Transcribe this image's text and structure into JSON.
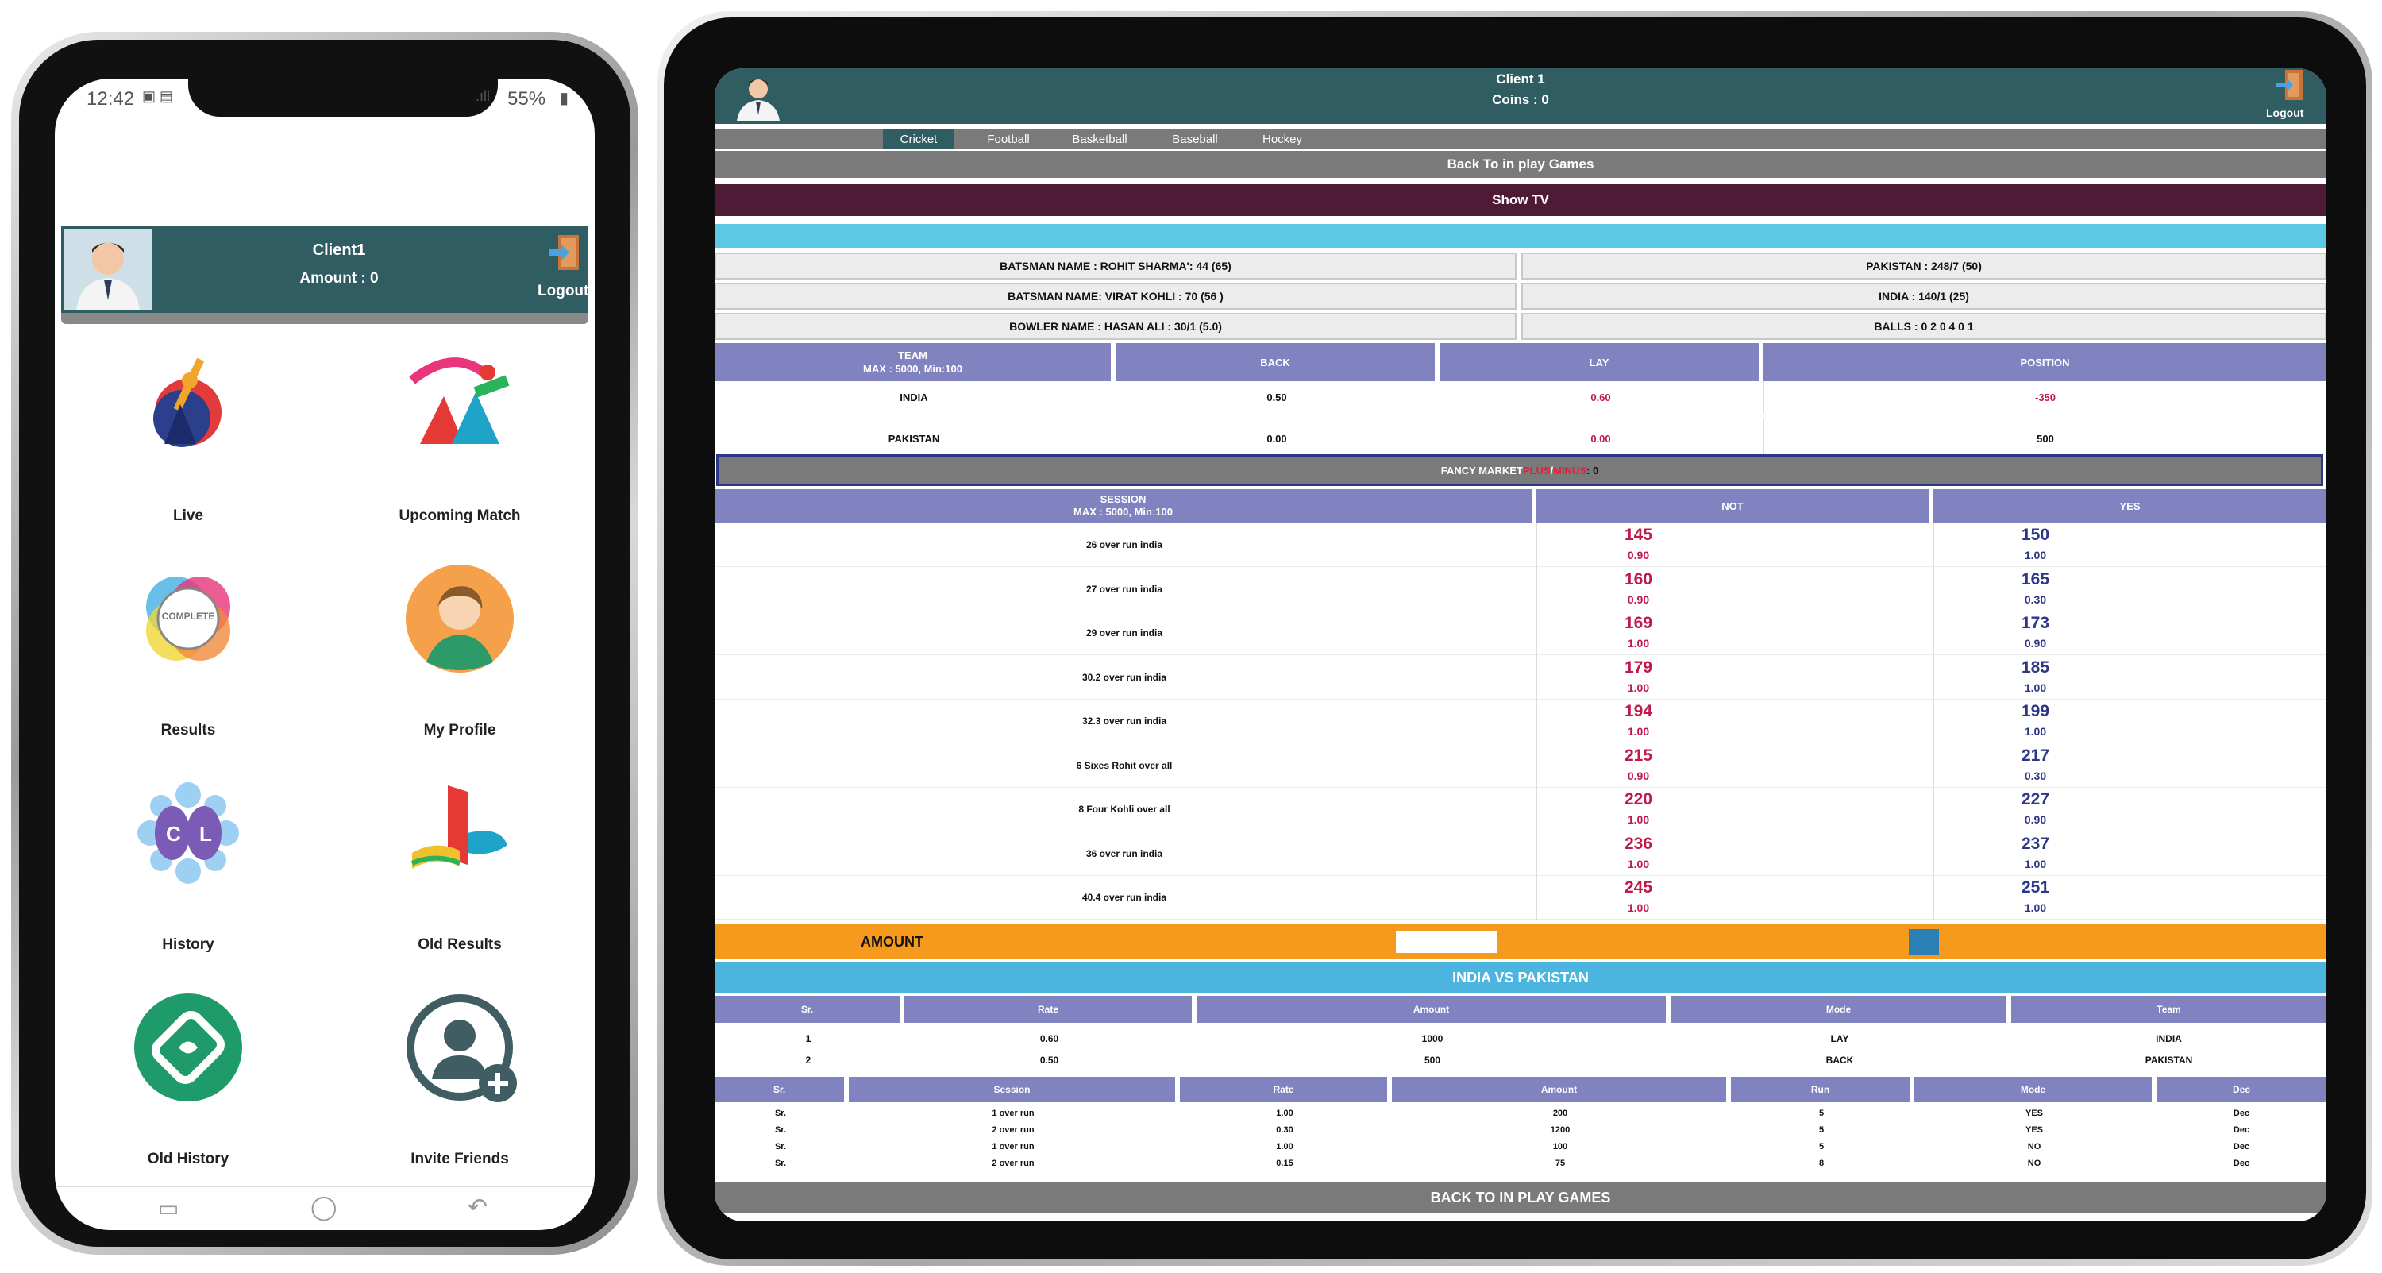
{
  "phone": {
    "status": {
      "time": "12:42",
      "battery": "55%"
    },
    "header": {
      "client": "Client1",
      "amount": "Amount : 0",
      "logout": "Logout"
    },
    "grid": [
      {
        "label": "Live",
        "icon": "cricket-batsman-icon"
      },
      {
        "label": "Upcoming Match",
        "icon": "upcoming-match-icon"
      },
      {
        "label": "Results",
        "icon": "results-complete-icon"
      },
      {
        "label": "My Profile",
        "icon": "profile-avatar-icon"
      },
      {
        "label": "History",
        "icon": "history-cl-icon"
      },
      {
        "label": "Old Results",
        "icon": "old-results-icon"
      },
      {
        "label": "Old History",
        "icon": "old-history-icon"
      },
      {
        "label": "Invite Friends",
        "icon": "invite-friends-icon"
      }
    ],
    "complete_badge": "COMPLETE"
  },
  "tablet": {
    "header": {
      "client": "Client 1",
      "coins": "Coins : 0",
      "logout": "Logout"
    },
    "tabs": [
      "Cricket",
      "Football",
      "Basketball",
      "Baseball",
      "Hockey"
    ],
    "back_top": "Back To in play Games",
    "show_tv": "Show TV",
    "score": {
      "left": [
        "BATSMAN NAME : ROHIT SHARMA': 44 (65)",
        "BATSMAN NAME: VIRAT KOHLI : 70 (56 )",
        "BOWLER NAME : HASAN ALI : 30/1 (5.0)"
      ],
      "right": [
        "PAKISTAN : 248/7 (50)",
        "INDIA : 140/1 (25)",
        "BALLS : 0 2 0 4 0 1"
      ]
    },
    "match_table": {
      "team_header": "TEAM",
      "team_limit": "MAX : 5000, Min:100",
      "back": "BACK",
      "lay": "LAY",
      "position": "POSITION",
      "rows": [
        {
          "team": "INDIA",
          "back": "0.50",
          "lay": "0.60",
          "position": "-350"
        },
        {
          "team": "PAKISTAN",
          "back": "0.00",
          "lay": "0.00",
          "position": "500"
        }
      ]
    },
    "fancy": {
      "label": "FANCY MARKET ",
      "plus": "PLUS",
      "slash": "/",
      "minus": "MINUS",
      "value": " : 0"
    },
    "session_table": {
      "session_header": "SESSION",
      "session_limit": "MAX : 5000, Min:100",
      "not": "NOT",
      "yes": "YES",
      "rows": [
        {
          "name": "26 over run india",
          "not": "145",
          "not_rate": "0.90",
          "yes": "150",
          "yes_rate": "1.00"
        },
        {
          "name": "27 over run india",
          "not": "160",
          "not_rate": "0.90",
          "yes": "165",
          "yes_rate": "0.30"
        },
        {
          "name": "29 over run india",
          "not": "169",
          "not_rate": "1.00",
          "yes": "173",
          "yes_rate": "0.90"
        },
        {
          "name": "30.2 over run india",
          "not": "179",
          "not_rate": "1.00",
          "yes": "185",
          "yes_rate": "1.00"
        },
        {
          "name": "32.3 over run india",
          "not": "194",
          "not_rate": "1.00",
          "yes": "199",
          "yes_rate": "1.00"
        },
        {
          "name": "6 Sixes Rohit  over all",
          "not": "215",
          "not_rate": "0.90",
          "yes": "217",
          "yes_rate": "0.30"
        },
        {
          "name": "8 Four Kohli over all",
          "not": "220",
          "not_rate": "1.00",
          "yes": "227",
          "yes_rate": "0.90"
        },
        {
          "name": "36 over run india",
          "not": "236",
          "not_rate": "1.00",
          "yes": "237",
          "yes_rate": "1.00"
        },
        {
          "name": "40.4 over run india",
          "not": "245",
          "not_rate": "1.00",
          "yes": "251",
          "yes_rate": "1.00"
        }
      ]
    },
    "amount_label": "AMOUNT",
    "amount_input": "",
    "vs_title": "INDIA VS PAKISTAN",
    "bets_table": {
      "headers": [
        "Sr.",
        "Rate",
        "Amount",
        "Mode",
        "Team"
      ],
      "rows": [
        [
          "1",
          "0.60",
          "1000",
          "LAY",
          "INDIA"
        ],
        [
          "2",
          "0.50",
          "500",
          "BACK",
          "PAKISTAN"
        ]
      ]
    },
    "session_bets": {
      "headers": [
        "Sr.",
        "Session",
        "Rate",
        "Amount",
        "Run",
        "Mode",
        "Dec"
      ],
      "rows": [
        [
          "Sr.",
          "1 over run",
          "1.00",
          "200",
          "5",
          "YES",
          "Dec"
        ],
        [
          "Sr.",
          "2 over run",
          "0.30",
          "1200",
          "5",
          "YES",
          "Dec"
        ],
        [
          "Sr.",
          "1 over run",
          "1.00",
          "100",
          "5",
          "NO",
          "Dec"
        ],
        [
          "Sr.",
          "2 over run",
          "0.15",
          "75",
          "8",
          "NO",
          "Dec"
        ]
      ]
    },
    "back_bottom": "BACK TO IN PLAY GAMES"
  },
  "colors": {
    "header": "#2f5d62",
    "tab_gray": "#7a7a7a",
    "tv": "#4e1a36",
    "sky": "#5bc8e4",
    "table_header": "#8182c0",
    "amount_bar": "#f59a1c",
    "vs_bar": "#4bb5e0",
    "red": "#c0194a",
    "blue": "#2c3787"
  }
}
